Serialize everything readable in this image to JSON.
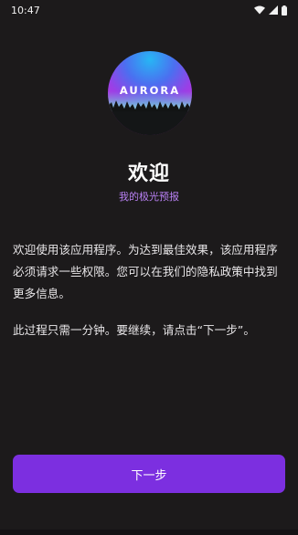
{
  "status_bar": {
    "time": "10:47",
    "icons": [
      "wifi-icon",
      "signal-icon",
      "battery-icon"
    ]
  },
  "logo": {
    "text": "AURORA"
  },
  "welcome": {
    "title": "欢迎",
    "subtitle": "我的极光预报"
  },
  "content": {
    "paragraph1": "欢迎使用该应用程序。为达到最佳效果，该应用程序必须请求一些权限。您可以在我们的隐私政策中找到更多信息。",
    "paragraph2": "此过程只需一分钟。要继续，请点击“下一步”。"
  },
  "actions": {
    "next_label": "下一步"
  },
  "colors": {
    "background": "#1c1a1b",
    "accent": "#7c2fe0",
    "subtitle": "#b880f3"
  }
}
